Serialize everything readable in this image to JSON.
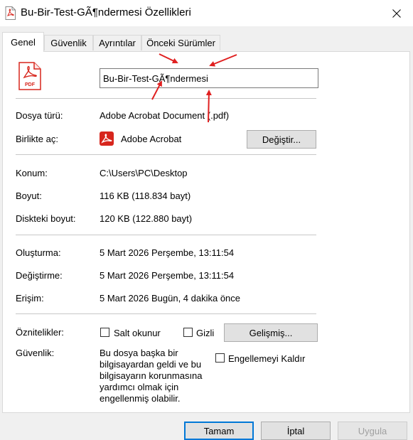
{
  "window": {
    "title": "Bu-Bir-Test-GÃ¶ndermesi Özellikleri",
    "close_icon": "close-icon"
  },
  "tabs": [
    {
      "label": "Genel",
      "active": true
    },
    {
      "label": "Güvenlik",
      "active": false
    },
    {
      "label": "Ayrıntılar",
      "active": false
    },
    {
      "label": "Önceki Sürümler",
      "active": false
    }
  ],
  "file": {
    "icon": "pdf-file-icon",
    "icon_text": "PDF",
    "name": "Bu-Bir-Test-GÃ¶ndermesi"
  },
  "general": {
    "type_label": "Dosya türü:",
    "type_value": "Adobe Acrobat Document (.pdf)",
    "opens_label": "Birlikte aç:",
    "opens_value": "Adobe Acrobat",
    "change_button": "Değiştir...",
    "location_label": "Konum:",
    "location_value": "C:\\Users\\PC\\Desktop",
    "size_label": "Boyut:",
    "size_value": "116 KB (118.834 bayt)",
    "disk_size_label": "Diskteki boyut:",
    "disk_size_value": "120 KB (122.880 bayt)",
    "created_label": "Oluşturma:",
    "created_value": "5 Mart 2026 Perşembe, 13:11:54",
    "modified_label": "Değiştirme:",
    "modified_value": "5 Mart 2026 Perşembe, 13:11:54",
    "accessed_label": "Erişim:",
    "accessed_value": "5 Mart 2026 Bugün, 4 dakika önce",
    "attributes_label": "Öznitelikler:",
    "readonly_label": "Salt okunur",
    "readonly_checked": false,
    "hidden_label": "Gizli",
    "hidden_checked": false,
    "advanced_button": "Gelişmiş...",
    "security_label": "Güvenlik:",
    "security_text": "Bu dosya başka bir bilgisayardan geldi ve bu bilgisayarın korunmasına yardımcı olmak için engellenmiş olabilir.",
    "unblock_label": "Engellemeyi Kaldır",
    "unblock_checked": false
  },
  "footer": {
    "ok": "Tamam",
    "cancel": "İptal",
    "apply": "Uygula"
  },
  "colors": {
    "annotation_arrow": "#e02020",
    "pdf_red": "#d7261d",
    "accent_blue": "#0078d7"
  }
}
